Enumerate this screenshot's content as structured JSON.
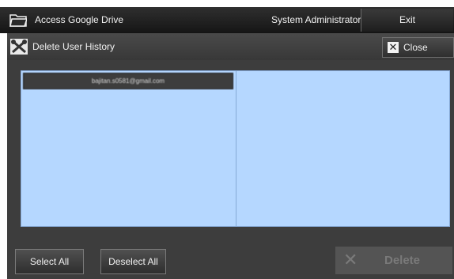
{
  "topbar": {
    "title": "Access Google Drive",
    "user": "System Administrator",
    "exit_label": "Exit",
    "icon": "folder-icon"
  },
  "dialog": {
    "title": "Delete User History",
    "icon": "tools-icon",
    "close_label": "Close"
  },
  "history_list": {
    "items": [
      {
        "label": "bajitan.s0581@gmail.com"
      }
    ]
  },
  "buttons": {
    "select_all": "Select All",
    "deselect_all": "Deselect All",
    "delete": "Delete"
  },
  "colors": {
    "list_background": "#b5d7ff",
    "topbar": "#1e1e1e",
    "dialog_background": "#3d3d3d",
    "disabled_delete": "#545454"
  }
}
